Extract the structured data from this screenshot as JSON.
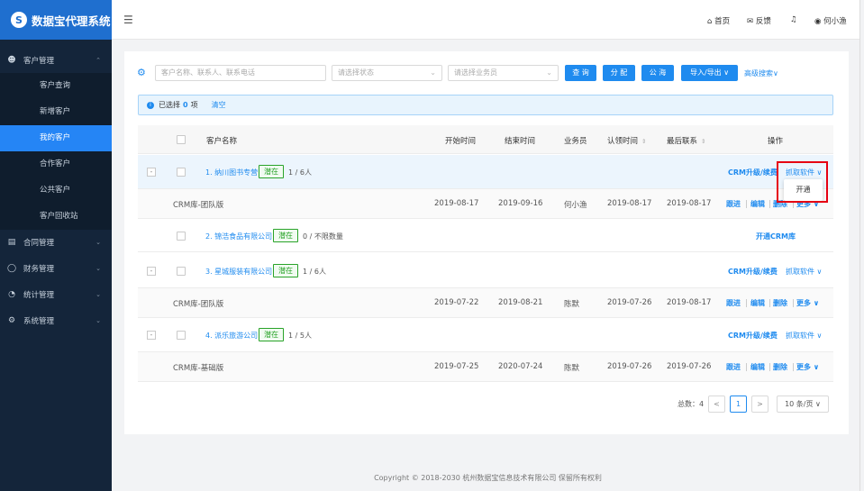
{
  "app": {
    "title": "数据宝代理系统",
    "logo_letter": "S"
  },
  "sidebar": {
    "customer_menu": "客户管理",
    "customer_items": [
      "客户查询",
      "新增客户",
      "我的客户",
      "合作客户",
      "公共客户",
      "客户回收站"
    ],
    "active_index": 2,
    "other_menus": [
      "合同管理",
      "财务管理",
      "统计管理",
      "系统管理"
    ]
  },
  "topbar": {
    "home": "首页",
    "feedback": "反馈",
    "user": "何小渔"
  },
  "filters": {
    "search_placeholder": "客户名称、联系人、联系电话",
    "status_placeholder": "请选择状态",
    "staff_placeholder": "请选择业务员",
    "query": "查 询",
    "assign": "分 配",
    "public_pool": "公 海",
    "import_export": "导入/导出 ∨",
    "advanced": "高级搜索∨"
  },
  "selection": {
    "prefix": "已选择",
    "count": "0",
    "suffix": "项",
    "clear": "清空"
  },
  "table": {
    "headers": {
      "name": "客户名称",
      "start": "开始时间",
      "end": "结束时间",
      "staff": "业务员",
      "claim": "认领时间",
      "last": "最后联系",
      "ops": "操作"
    },
    "rows": [
      {
        "name": "1. 纳川图书专营",
        "tag": "潜在",
        "people": "1 / 6人",
        "op1": "CRM升级/续费",
        "op2": "抓取软件 ∨",
        "sub": {
          "product": "CRM库-团队版",
          "start": "2019-08-17",
          "end": "2019-09-16",
          "staff": "何小渔",
          "claim": "2019-08-17",
          "last": "2019-08-17"
        }
      },
      {
        "name": "2. 锦浩食品有限公司",
        "tag": "潜在",
        "people": "0 / 不限数量",
        "op1": "开通CRM库"
      },
      {
        "name": "3. 星城服装有限公司",
        "tag": "潜在",
        "people": "1 / 6人",
        "op1": "CRM升级/续费",
        "op2": "抓取软件 ∨",
        "sub": {
          "product": "CRM库-团队版",
          "start": "2019-07-22",
          "end": "2019-08-21",
          "staff": "陈默",
          "claim": "2019-07-26",
          "last": "2019-08-17"
        }
      },
      {
        "name": "4. 派乐旅游公司",
        "tag": "潜在",
        "people": "1 / 5人",
        "op1": "CRM升级/续费",
        "op2": "抓取软件 ∨",
        "sub": {
          "product": "CRM库-基础版",
          "start": "2019-07-25",
          "end": "2020-07-24",
          "staff": "陈默",
          "claim": "2019-07-26",
          "last": "2019-07-26"
        }
      }
    ],
    "sub_ops": {
      "follow": "跟进",
      "edit": "编辑",
      "del": "删除",
      "more": "更多 ∨"
    }
  },
  "dropdown": {
    "item": "开通"
  },
  "pagination": {
    "total": "总数：4",
    "prev": "<",
    "page": "1",
    "next": ">",
    "size": "10 条/页 ∨"
  },
  "footer": "Copyright © 2018-2030 杭州数据宝信息技术有限公司 保留所有权利"
}
